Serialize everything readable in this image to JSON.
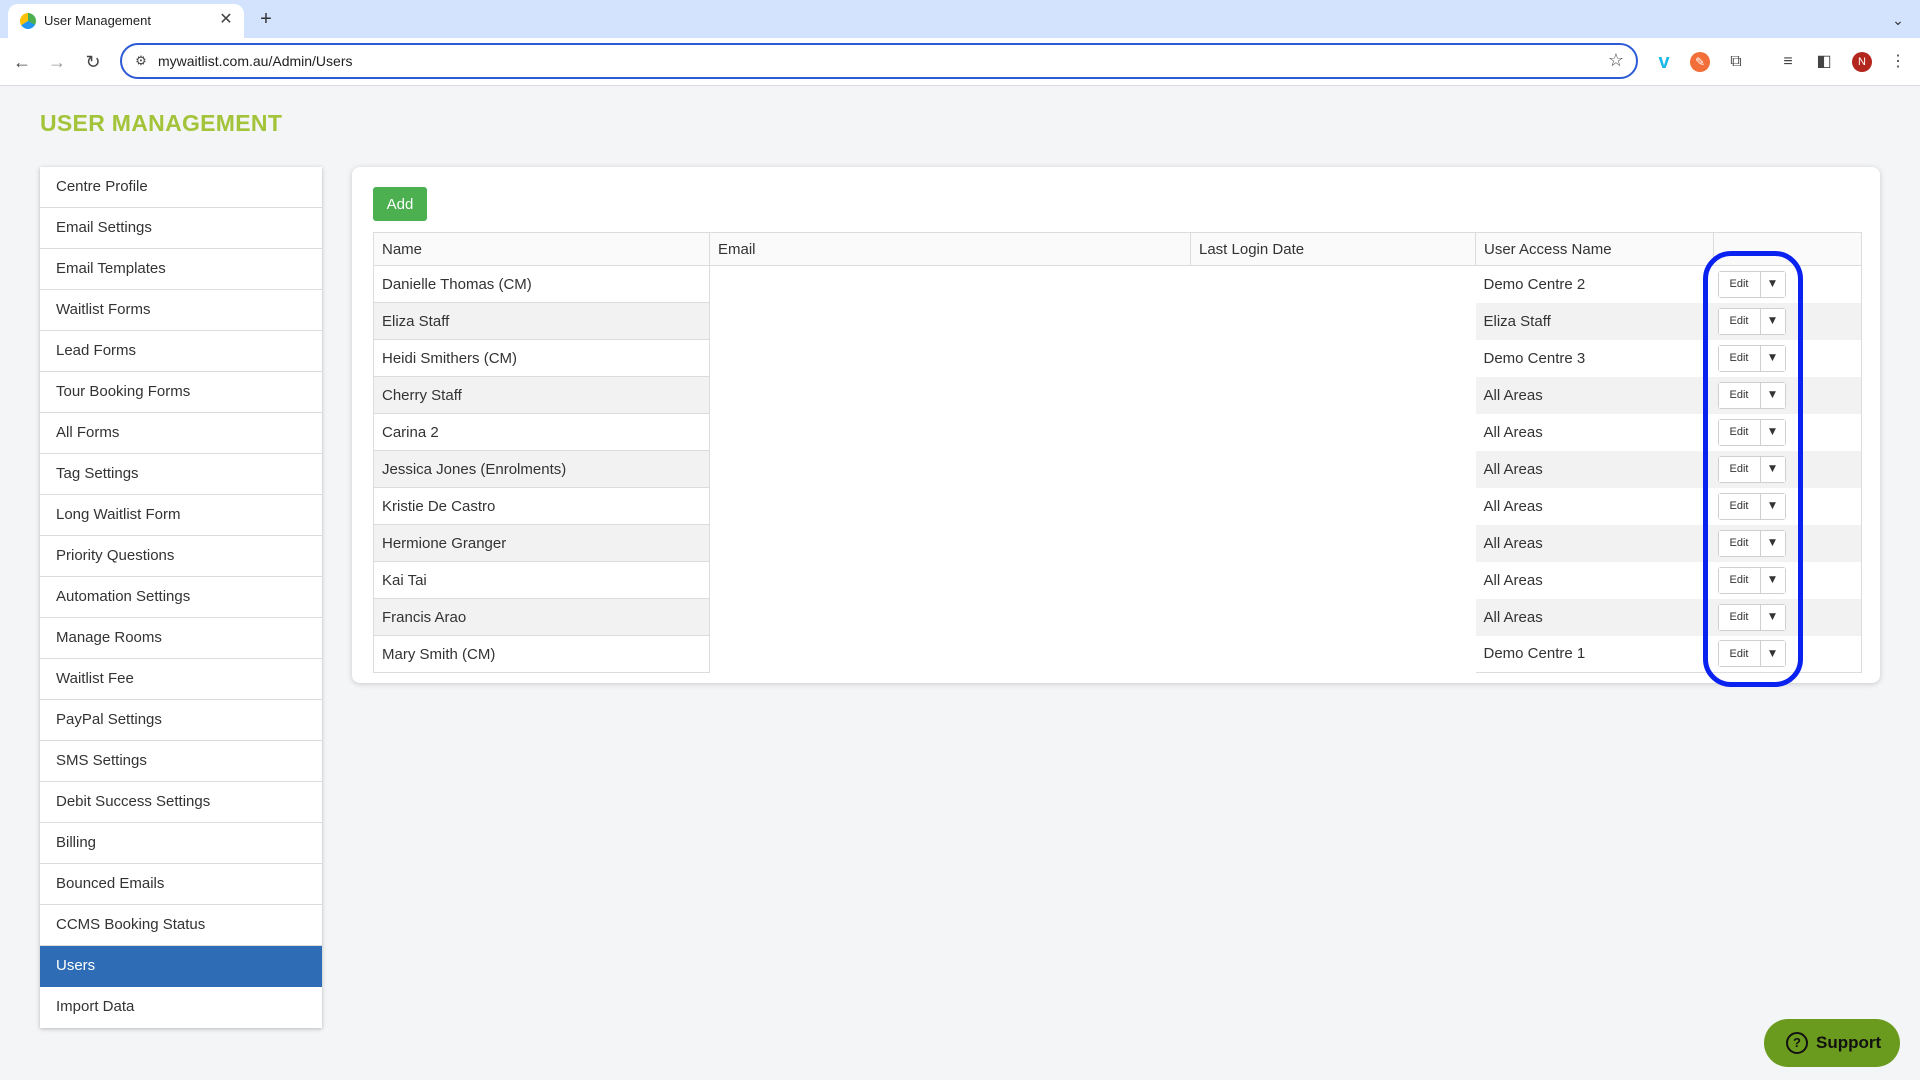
{
  "browser": {
    "tab_title": "User Management",
    "tab_close": "✕",
    "new_tab": "+",
    "tab_menu": "⌄",
    "url": "mywaitlist.com.au/Admin/Users",
    "profile_initial": "N",
    "icons": [
      "back-arrow-icon",
      "forward-arrow-icon",
      "reload-icon",
      "site-settings-icon",
      "star-icon",
      "vimeo-extension-icon",
      "orange-extension-icon",
      "puzzle-extensions-icon",
      "media-controls-icon",
      "side-panel-icon",
      "kebab-menu-icon"
    ]
  },
  "page": {
    "title": "USER MANAGEMENT"
  },
  "sidebar": {
    "active_color": "#2e6db5",
    "items": [
      {
        "label": "Centre Profile"
      },
      {
        "label": "Email Settings"
      },
      {
        "label": "Email Templates"
      },
      {
        "label": "Waitlist Forms"
      },
      {
        "label": "Lead Forms"
      },
      {
        "label": "Tour Booking Forms"
      },
      {
        "label": "All Forms"
      },
      {
        "label": "Tag Settings"
      },
      {
        "label": "Long Waitlist Form"
      },
      {
        "label": "Priority Questions"
      },
      {
        "label": "Automation Settings"
      },
      {
        "label": "Manage Rooms"
      },
      {
        "label": "Waitlist Fee"
      },
      {
        "label": "PayPal Settings"
      },
      {
        "label": "SMS Settings"
      },
      {
        "label": "Debit Success Settings"
      },
      {
        "label": "Billing"
      },
      {
        "label": "Bounced Emails"
      },
      {
        "label": "CCMS Booking Status"
      },
      {
        "label": "Users",
        "active": true
      },
      {
        "label": "Import Data"
      }
    ]
  },
  "main": {
    "add_label": "Add",
    "add_color": "#4caf50",
    "columns": [
      "Name",
      "Email",
      "Last Login Date",
      "User Access Name",
      ""
    ],
    "edit_label": "Edit",
    "caret": "▼",
    "rows": [
      {
        "name": "Danielle Thomas (CM)",
        "email": "",
        "last_login": "",
        "access": "Demo Centre 2"
      },
      {
        "name": "Eliza Staff",
        "email": "",
        "last_login": "",
        "access": "Eliza Staff"
      },
      {
        "name": "Heidi Smithers (CM)",
        "email": "",
        "last_login": "",
        "access": "Demo Centre 3"
      },
      {
        "name": "Cherry Staff",
        "email": "",
        "last_login": "",
        "access": "All Areas"
      },
      {
        "name": "Carina 2",
        "email": "",
        "last_login": "",
        "access": "All Areas"
      },
      {
        "name": "Jessica Jones (Enrolments)",
        "email": "",
        "last_login": "",
        "access": "All Areas"
      },
      {
        "name": "Kristie De Castro",
        "email": "",
        "last_login": "",
        "access": "All Areas"
      },
      {
        "name": "Hermione Granger",
        "email": "",
        "last_login": "",
        "access": "All Areas"
      },
      {
        "name": "Kai Tai",
        "email": "",
        "last_login": "",
        "access": "All Areas"
      },
      {
        "name": "Francis Arao",
        "email": "",
        "last_login": "",
        "access": "All Areas"
      },
      {
        "name": "Mary Smith (CM)",
        "email": "",
        "last_login": "",
        "access": "Demo Centre 1"
      }
    ]
  },
  "annotation": {
    "color": "#0a22f0"
  },
  "support": {
    "label": "Support",
    "icon": "?",
    "color": "#6b9b1e"
  }
}
